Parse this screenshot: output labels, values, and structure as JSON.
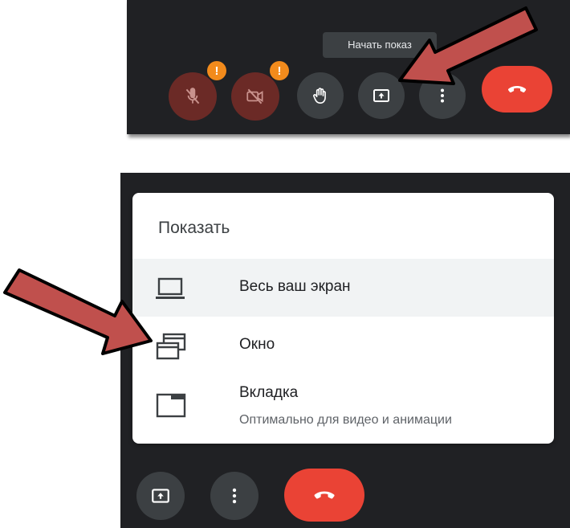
{
  "tooltip": {
    "text": "Начать показ"
  },
  "top_controls": [
    {
      "name": "microphone-off",
      "warning": "!"
    },
    {
      "name": "camera-off",
      "warning": "!"
    },
    {
      "name": "raise-hand"
    },
    {
      "name": "present-now"
    },
    {
      "name": "more-options"
    },
    {
      "name": "leave-call"
    }
  ],
  "menu": {
    "title": "Показать",
    "items": [
      {
        "icon": "laptop-icon",
        "label": "Весь ваш экран"
      },
      {
        "icon": "window-icon",
        "label": "Окно"
      },
      {
        "icon": "tab-icon",
        "label": "Вкладка",
        "sublabel": "Оптимально для видео и анимации"
      }
    ]
  },
  "colors": {
    "bar_bg": "#202124",
    "button_dark": "#3c4043",
    "button_muted": "#6b2a26",
    "end_call": "#ea4335",
    "warning": "#f28b1c",
    "arrow_fill": "#c0504d"
  }
}
